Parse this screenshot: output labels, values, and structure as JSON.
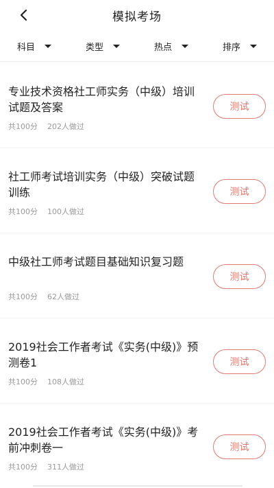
{
  "header": {
    "title": "模拟考场"
  },
  "filters": [
    {
      "label": "科目"
    },
    {
      "label": "类型"
    },
    {
      "label": "热点"
    },
    {
      "label": "排序"
    }
  ],
  "items": [
    {
      "title": "专业技术资格社工师实务（中级）培训试题及答案",
      "total": "共100分",
      "count": "202人做过",
      "button": "测试"
    },
    {
      "title": "社工师考试培训实务（中级）突破试题训练",
      "total": "共100分",
      "count": "100人做过",
      "button": "测试"
    },
    {
      "title": "中级社工师考试题目基础知识复习题",
      "total": "共100分",
      "count": "62人做过",
      "button": "测试"
    },
    {
      "title": "2019社会工作者考试《实务(中级)》预测卷1",
      "total": "共100分",
      "count": "108人做过",
      "button": "测试"
    },
    {
      "title": "2019社会工作者考试《实务(中级)》考前冲刺卷一",
      "total": "共100分",
      "count": "311人做过",
      "button": "测试"
    }
  ],
  "icons": {
    "back": "chevron-left-icon",
    "caret": "caret-down-icon"
  },
  "colors": {
    "accent": "#e07a72",
    "meta_text": "#999999"
  }
}
